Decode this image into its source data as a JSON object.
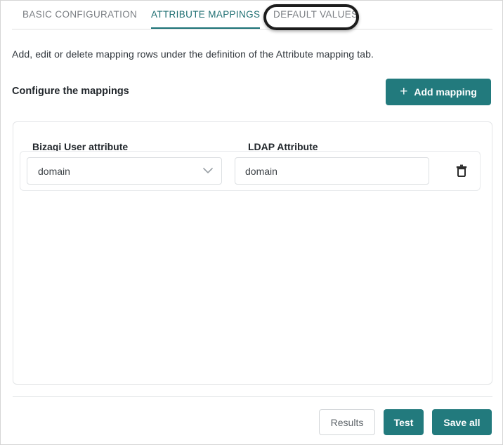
{
  "tabs": [
    {
      "id": "basic",
      "label": "BASIC CONFIGURATION",
      "active": false
    },
    {
      "id": "attr",
      "label": "ATTRIBUTE MAPPINGS",
      "active": true
    },
    {
      "id": "default",
      "label": "DEFAULT VALUES",
      "active": false
    }
  ],
  "annotation": {
    "target": "DEFAULT VALUES",
    "shape": "rounded-rectangle",
    "color": "#1c1c1c"
  },
  "description": "Add, edit or delete mapping rows under the definition of the Attribute mapping tab.",
  "section": {
    "title": "Configure the mappings",
    "add_button_label": "Add mapping",
    "add_button_icon": "plus-icon",
    "add_button_plus": "+"
  },
  "table": {
    "columns": [
      "Bizagi User attribute",
      "LDAP Attribute"
    ],
    "rows": [
      {
        "bizagi_attribute": "domain",
        "ldap_attribute": "domain",
        "ldap_placeholder": "",
        "delete_icon": "trash-icon"
      }
    ]
  },
  "footer": {
    "results_label": "Results",
    "test_label": "Test",
    "save_all_label": "Save all"
  },
  "colors": {
    "accent_teal": "#227a7d",
    "tab_active": "#1f6f72",
    "tab_inactive": "#7b7f84",
    "text_primary": "#22272c",
    "border": "#e3e5e7",
    "annotation": "#1c1c1c"
  }
}
